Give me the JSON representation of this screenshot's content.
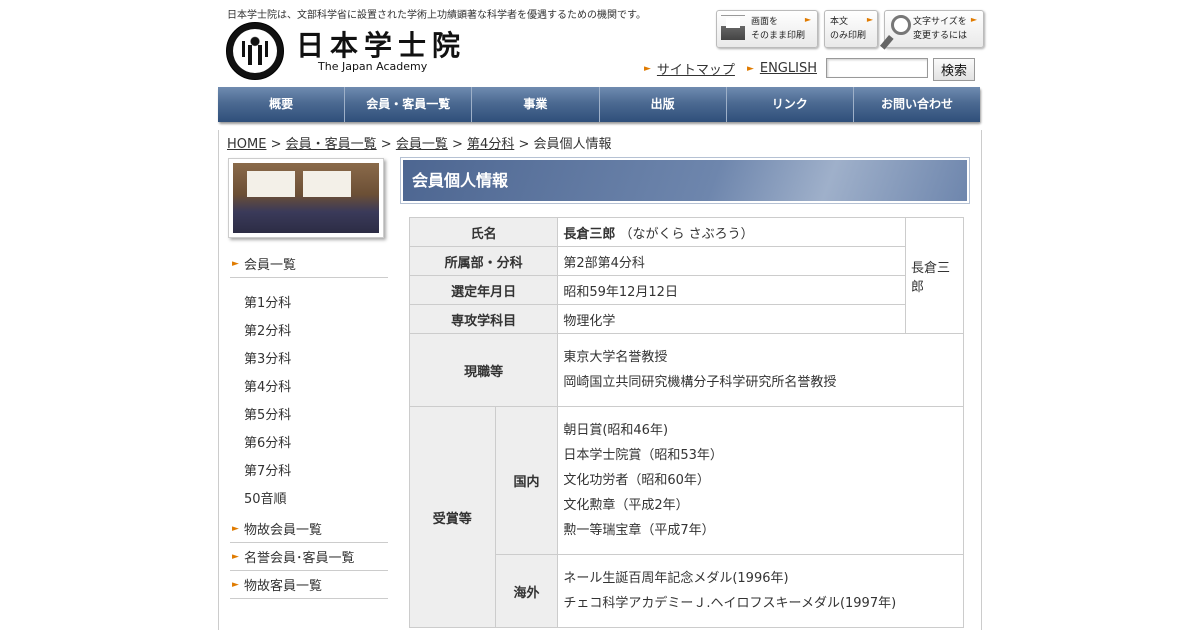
{
  "header": {
    "tagline": "日本学士院は、文部科学省に設置された学術上功績顕著な科学者を優遇するための機関です。",
    "logo_jp": "日本学士院",
    "logo_en": "The Japan Academy",
    "tools": {
      "print_screen": "画面を\nそのまま印刷",
      "print_text": "本文\nのみ印刷",
      "font_size": "文字サイズを\n変更するには"
    },
    "links": {
      "sitemap": "サイトマップ",
      "english": "ENGLISH"
    },
    "search": {
      "value": "",
      "button": "検索"
    }
  },
  "nav": [
    "概要",
    "会員・客員一覧",
    "事業",
    "出版",
    "リンク",
    "お問い合わせ"
  ],
  "breadcrumb": {
    "home": "HOME",
    "sep": ">",
    "l1": "会員・客員一覧",
    "l2": "会員一覧",
    "l3": "第4分科",
    "current": "会員個人情報"
  },
  "sidebar": {
    "members": "会員一覧",
    "sub": [
      "第1分科",
      "第2分科",
      "第3分科",
      "第4分科",
      "第5分科",
      "第6分科",
      "第7分科",
      "50音順"
    ],
    "deceased": "物故会員一覧",
    "honorary": "名誉会員･客員一覧",
    "deceased_guests": "物故客員一覧"
  },
  "main": {
    "title": "会員個人情報",
    "rows": {
      "name_label": "氏名",
      "name": "長倉三郎",
      "reading": "（ながくら さぶろう）",
      "section_label": "所属部・分科",
      "section": "第2部第4分科",
      "date_label": "選定年月日",
      "date": "昭和59年12月12日",
      "field_label": "専攻学科目",
      "field": "物理化学",
      "position_label": "現職等",
      "positions": [
        "東京大学名誉教授",
        "岡崎国立共同研究機構分子科学研究所名誉教授"
      ],
      "awards_label": "受賞等",
      "domestic_label": "国内",
      "domestic": [
        "朝日賞(昭和46年)",
        "日本学士院賞（昭和53年）",
        "文化功労者（昭和60年）",
        "文化勲章（平成2年）",
        "勲一等瑞宝章（平成7年）"
      ],
      "overseas_label": "海外",
      "overseas": [
        "ネール生誕百周年記念メダル(1996年)",
        "チェコ科学アカデミーＪ.ヘイロフスキーメダル(1997年)"
      ]
    },
    "photo_alt": "長倉三郎"
  }
}
